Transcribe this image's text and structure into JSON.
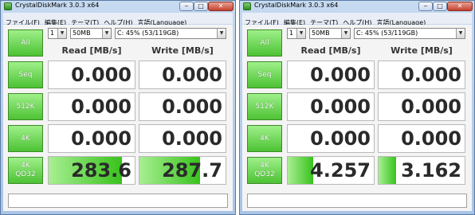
{
  "windows": [
    {
      "title": "CrystalDiskMark 3.0.3 x64",
      "menu": [
        "ファイル(F)",
        "編集(E)",
        "テーマ(T)",
        "ヘルプ(H)",
        "言語(Language)"
      ],
      "controls": {
        "count": "1",
        "size": "50MB",
        "drive": "C: 45% (53/119GB)"
      },
      "headers": {
        "read": "Read [MB/s]",
        "write": "Write [MB/s]"
      },
      "all_label": "All",
      "rows": [
        {
          "label": [
            "Seq"
          ],
          "read": "0.000",
          "write": "0.000",
          "read_fill": 0,
          "write_fill": 0
        },
        {
          "label": [
            "512K"
          ],
          "read": "0.000",
          "write": "0.000",
          "read_fill": 0,
          "write_fill": 0
        },
        {
          "label": [
            "4K"
          ],
          "read": "0.000",
          "write": "0.000",
          "read_fill": 0,
          "write_fill": 0
        },
        {
          "label": [
            "4K",
            "QD32"
          ],
          "read": "283.6",
          "write": "287.7",
          "read_fill": 0.85,
          "write_fill": 0.7
        }
      ],
      "status": ""
    },
    {
      "title": "CrystalDiskMark 3.0.3 x64",
      "menu": [
        "ファイル(F)",
        "編集(E)",
        "テーマ(T)",
        "ヘルプ(H)",
        "言語(Language)"
      ],
      "controls": {
        "count": "1",
        "size": "50MB",
        "drive": "C: 45% (53/119GB)"
      },
      "headers": {
        "read": "Read [MB/s]",
        "write": "Write [MB/s]"
      },
      "all_label": "All",
      "rows": [
        {
          "label": [
            "Seq"
          ],
          "read": "0.000",
          "write": "0.000",
          "read_fill": 0,
          "write_fill": 0
        },
        {
          "label": [
            "512K"
          ],
          "read": "0.000",
          "write": "0.000",
          "read_fill": 0,
          "write_fill": 0
        },
        {
          "label": [
            "4K"
          ],
          "read": "0.000",
          "write": "0.000",
          "read_fill": 0,
          "write_fill": 0
        },
        {
          "label": [
            "4K",
            "QD32"
          ],
          "read": "4.257",
          "write": "3.162",
          "read_fill": 0.3,
          "write_fill": 0.2
        }
      ],
      "status": ""
    }
  ]
}
